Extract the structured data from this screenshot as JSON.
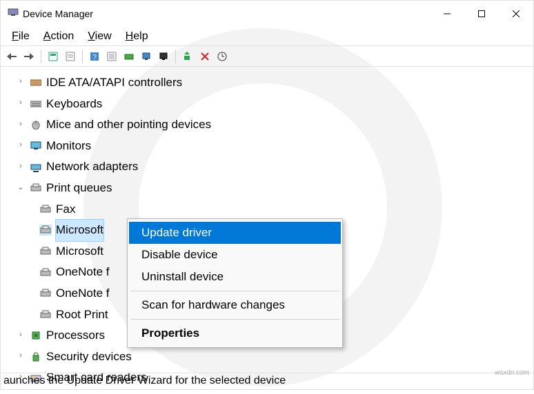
{
  "window": {
    "title": "Device Manager"
  },
  "menubar": {
    "file": "File",
    "action": "Action",
    "view": "View",
    "help": "Help"
  },
  "tree": {
    "ide": "IDE ATA/ATAPI controllers",
    "keyboards": "Keyboards",
    "mice": "Mice and other pointing devices",
    "monitors": "Monitors",
    "network": "Network adapters",
    "printq": "Print queues",
    "printq_children": {
      "fax": "Fax",
      "microsoft1": "Microsoft",
      "microsoft2": "Microsoft",
      "onenote1": "OneNote f",
      "onenote2": "OneNote f",
      "rootprint": "Root Print"
    },
    "processors": "Processors",
    "security": "Security devices",
    "smartcard": "Smart card readers"
  },
  "context_menu": {
    "update": "Update driver",
    "disable": "Disable device",
    "uninstall": "Uninstall device",
    "scan": "Scan for hardware changes",
    "properties": "Properties"
  },
  "statusbar": {
    "text": "aunches the Update Driver Wizard for the selected device"
  },
  "watermark": "wsxdn.com"
}
